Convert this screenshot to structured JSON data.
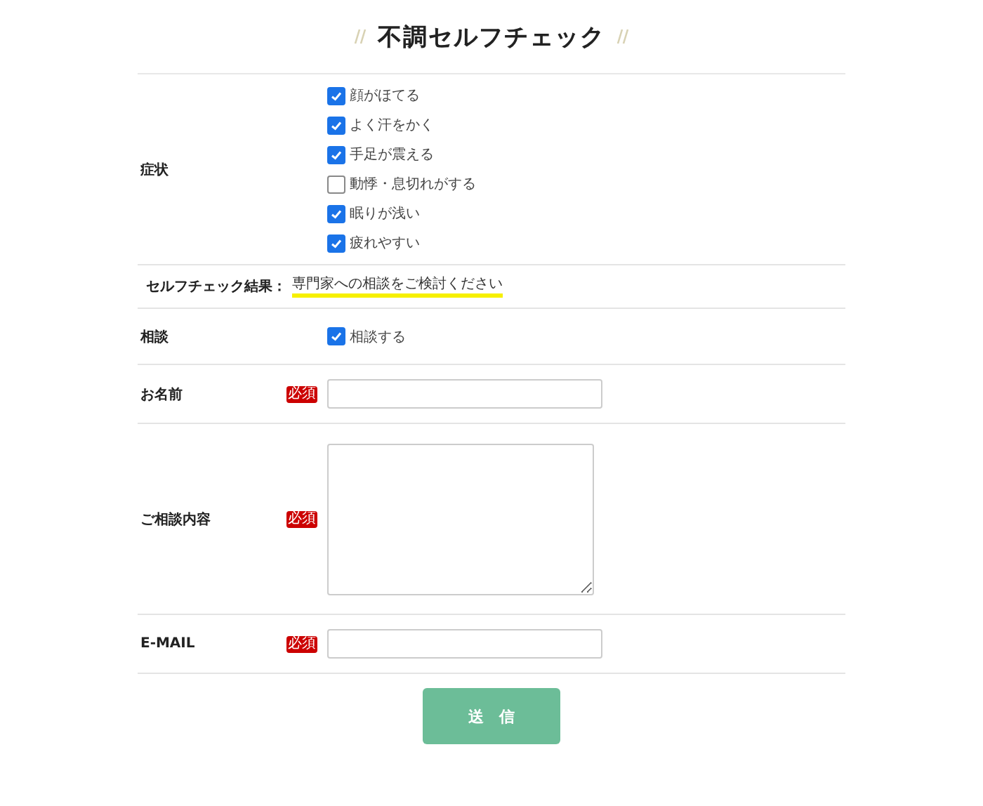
{
  "title": "不調セルフチェック",
  "symptoms": {
    "label": "症状",
    "options": [
      {
        "label": "顔がほてる",
        "checked": true
      },
      {
        "label": "よく汗をかく",
        "checked": true
      },
      {
        "label": "手足が震える",
        "checked": true
      },
      {
        "label": "動悸・息切れがする",
        "checked": false
      },
      {
        "label": "眠りが浅い",
        "checked": true
      },
      {
        "label": "疲れやすい",
        "checked": true
      }
    ]
  },
  "result": {
    "label": "セルフチェック結果：",
    "value": "専門家への相談をご検討ください"
  },
  "consult": {
    "label": "相談",
    "option": {
      "label": "相談する",
      "checked": true
    }
  },
  "fields": [
    {
      "label": "お名前",
      "required": true,
      "required_label": "必須",
      "kind": "input"
    },
    {
      "label": "ご相談内容",
      "required": true,
      "required_label": "必須",
      "kind": "textarea"
    },
    {
      "label": "E-MAIL",
      "required": true,
      "required_label": "必須",
      "kind": "input"
    }
  ],
  "submit": "送　信"
}
